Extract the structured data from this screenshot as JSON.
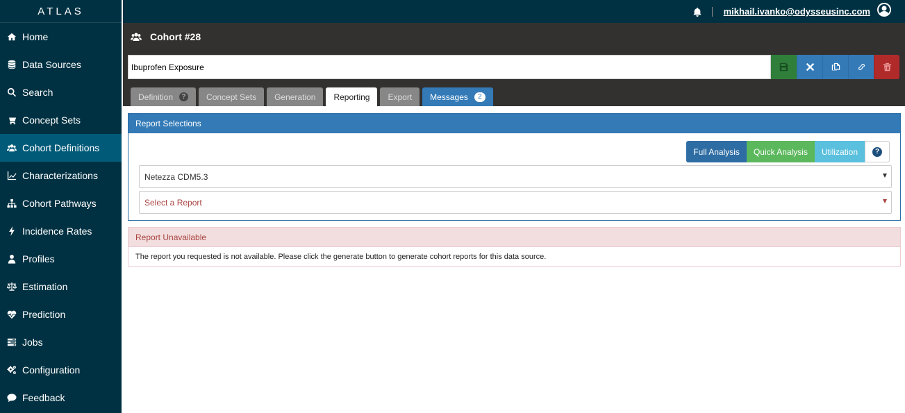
{
  "app": {
    "brand": "ATLAS"
  },
  "sidebar": {
    "items": [
      {
        "label": "Home",
        "icon": "home-icon"
      },
      {
        "label": "Data Sources",
        "icon": "database-icon"
      },
      {
        "label": "Search",
        "icon": "search-icon"
      },
      {
        "label": "Concept Sets",
        "icon": "cart-icon"
      },
      {
        "label": "Cohort Definitions",
        "icon": "users-icon",
        "active": true
      },
      {
        "label": "Characterizations",
        "icon": "line-chart-icon"
      },
      {
        "label": "Cohort Pathways",
        "icon": "sitemap-icon"
      },
      {
        "label": "Incidence Rates",
        "icon": "bolt-icon"
      },
      {
        "label": "Profiles",
        "icon": "user-icon"
      },
      {
        "label": "Estimation",
        "icon": "balance-scale-icon"
      },
      {
        "label": "Prediction",
        "icon": "heartbeat-icon"
      },
      {
        "label": "Jobs",
        "icon": "tasks-icon"
      },
      {
        "label": "Configuration",
        "icon": "cogs-icon"
      },
      {
        "label": "Feedback",
        "icon": "comment-icon"
      }
    ]
  },
  "header": {
    "user_email": "mikhail.ivanko@odysseusinc.com"
  },
  "cohort": {
    "title": "Cohort #28",
    "name_value": "Ibuprofen Exposure",
    "tabs": [
      {
        "label": "Definition",
        "has_help": true
      },
      {
        "label": "Concept Sets"
      },
      {
        "label": "Generation"
      },
      {
        "label": "Reporting",
        "active": true
      },
      {
        "label": "Export"
      },
      {
        "label": "Messages",
        "count": "2"
      }
    ]
  },
  "report_selections": {
    "heading": "Report Selections",
    "analysis_buttons": {
      "full": "Full Analysis",
      "quick": "Quick Analysis",
      "utilization": "Utilization",
      "help": "?"
    },
    "source_selected": "Netezza CDM5.3",
    "report_placeholder": "Select a Report"
  },
  "alert": {
    "title": "Report Unavailable",
    "message": "The report you requested is not available. Please click the generate button to generate cohort reports for this data source."
  },
  "colors": {
    "sidebar_bg": "#003142",
    "active_nav": "#005a78",
    "primary": "#337ab7",
    "success": "#5cb85c",
    "info": "#5bc0de",
    "danger": "#b12a2a"
  }
}
